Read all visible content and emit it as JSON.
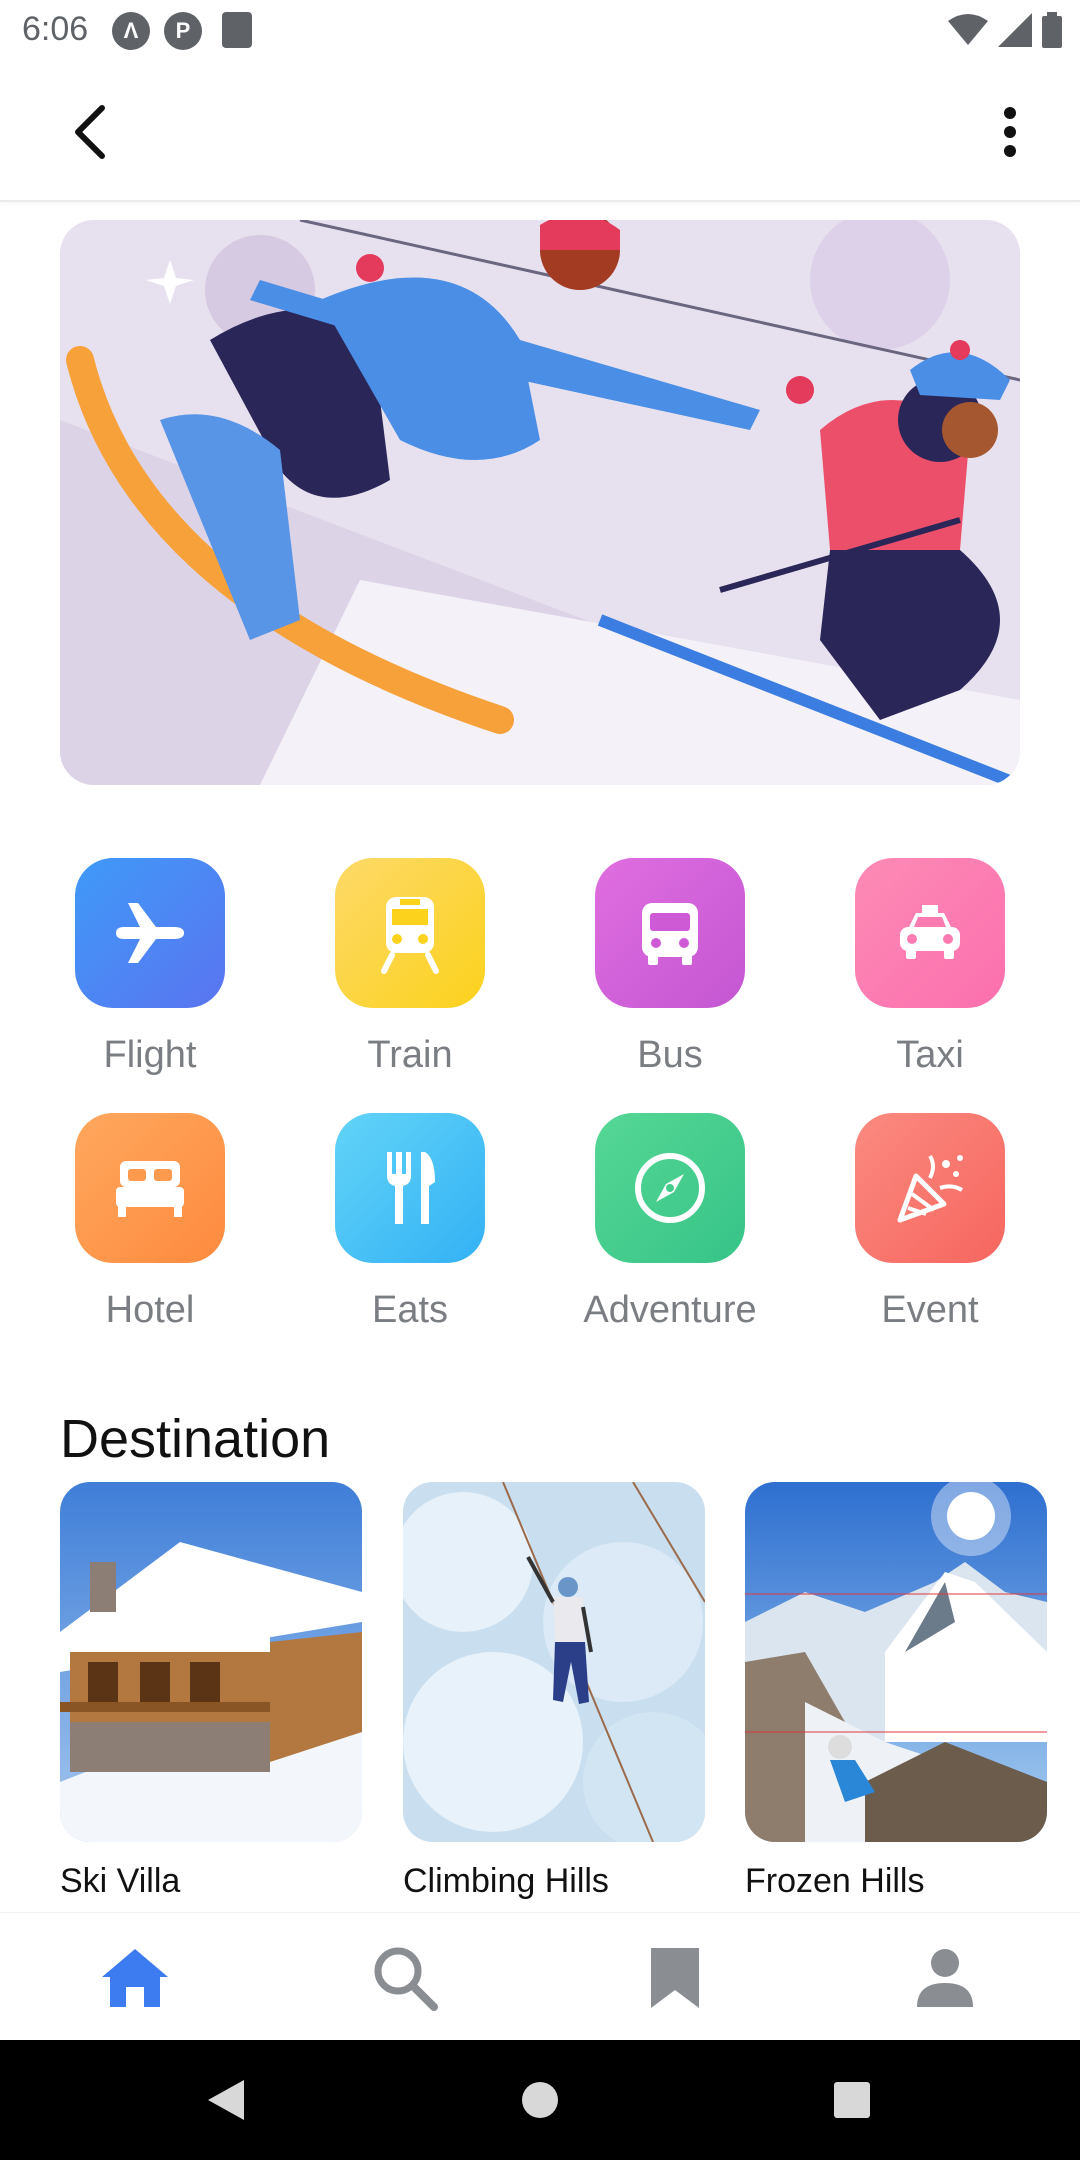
{
  "status_bar": {
    "time": "6:06"
  },
  "categories": [
    {
      "label": "Flight",
      "icon": "airplane-icon"
    },
    {
      "label": "Train",
      "icon": "train-icon"
    },
    {
      "label": "Bus",
      "icon": "bus-icon"
    },
    {
      "label": "Taxi",
      "icon": "taxi-icon"
    },
    {
      "label": "Hotel",
      "icon": "bed-icon"
    },
    {
      "label": "Eats",
      "icon": "fork-knife-icon"
    },
    {
      "label": "Adventure",
      "icon": "compass-icon"
    },
    {
      "label": "Event",
      "icon": "party-popper-icon"
    }
  ],
  "destination": {
    "title": "Destination",
    "items": [
      {
        "label": "Ski Villa"
      },
      {
        "label": "Climbing Hills"
      },
      {
        "label": "Frozen Hills"
      }
    ]
  },
  "bottom_nav": {
    "items": [
      {
        "icon": "home-icon",
        "active": true
      },
      {
        "icon": "search-icon",
        "active": false
      },
      {
        "icon": "bookmark-icon",
        "active": false
      },
      {
        "icon": "profile-icon",
        "active": false
      }
    ]
  },
  "colors": {
    "accent": "#3d7bf0",
    "flight": "#4a86f7",
    "train": "#fbd43c",
    "bus": "#d05fd8",
    "taxi": "#fb77b4",
    "hotel": "#fd9b50",
    "eats": "#4dc3f6",
    "adventure": "#3ecf8e",
    "event": "#f8736e"
  }
}
